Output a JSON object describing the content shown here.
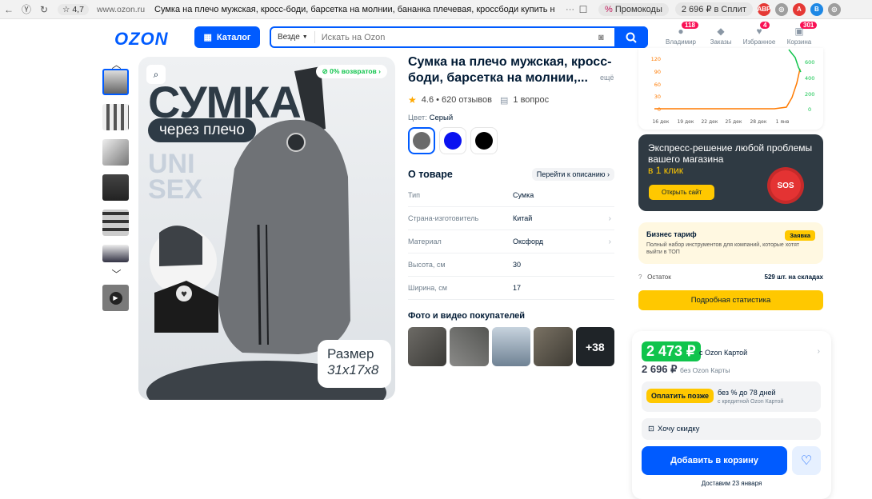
{
  "browser": {
    "rating": "☆ 4,7",
    "url": "www.ozon.ru",
    "title": "Сумка на плечо мужская, кросс-боди, барсетка на молнии, бананка плечевая, кроссбоди купить на OZON...",
    "promo_label": "Промокоды",
    "split_label": "2 696 ₽ в Сплит"
  },
  "header": {
    "logo": "OZON",
    "catalog_label": "Каталог",
    "search_scope": "Везде",
    "search_placeholder": "Искать на Ozon",
    "icons": [
      {
        "label": "Владимир",
        "badge": "118",
        "icon": "user-icon"
      },
      {
        "label": "Заказы",
        "badge": "",
        "icon": "box-icon"
      },
      {
        "label": "Избранное",
        "badge": "4",
        "icon": "heart-icon"
      },
      {
        "label": "Корзина",
        "badge": "301",
        "icon": "cart-icon"
      }
    ]
  },
  "gallery": {
    "returns_badge": "0% возвратов",
    "hero_word": "СУМКА",
    "hero_pill": "через плечо",
    "hero_uni": "UNI",
    "hero_sex": "SEX",
    "size_label": "Размер",
    "size_value": "31x17x8"
  },
  "product": {
    "title": "Сумка на плечо мужская, кросс-боди, барсетка на молнии,...",
    "more": "ещё",
    "rating": "4.6 • 620 отзывов",
    "questions": "1 вопрос",
    "color_label": "Цвет:",
    "color_value": "Серый",
    "swatches": [
      "#6b6b6b",
      "#0a12f0",
      "#000000"
    ],
    "about_title": "О товаре",
    "about_link": "Перейти к описанию",
    "specs": [
      {
        "k": "Тип",
        "v": "Сумка"
      },
      {
        "k": "Страна-изготовитель",
        "v": "Китай"
      },
      {
        "k": "Материал",
        "v": "Оксфорд"
      },
      {
        "k": "Высота, см",
        "v": "30"
      },
      {
        "k": "Ширина, см",
        "v": "17"
      }
    ],
    "photos_title": "Фото и видео покупателей",
    "photos_more": "+38"
  },
  "sidebar": {
    "chart": {
      "y_left": [
        "120",
        "90",
        "60",
        "30",
        "0"
      ],
      "y_right": [
        "600",
        "400",
        "200",
        "0"
      ],
      "x": [
        "16 дек",
        "19 дек",
        "22 дек",
        "25 дек",
        "28 дек",
        "1 янв"
      ]
    },
    "promo_text_1": "Экспресс-решение любой проблемы вашего магазина",
    "promo_text_2": "в 1 клик",
    "promo_btn": "Открыть сайт",
    "promo_badge": "SOS",
    "biz_title": "Бизнес тариф",
    "biz_tag": "Заявка",
    "biz_desc": "Полный набор инструментов для компаний, которые хотят выйти в ТОП",
    "stock_label": "Остаток",
    "stock_value": "529 шт. на складах",
    "stats_btn": "Подробная статистика"
  },
  "buy": {
    "price_card": "2 473 ₽",
    "price_card_label": "с Ozon Картой",
    "price": "2 696 ₽",
    "price_label": "без Ozon Карты",
    "split_btn": "Оплатить позже",
    "split_a": "без % до 78 дней",
    "split_b": "с кредитной Ozon Картой",
    "discount": "Хочу скидку",
    "cart_btn": "Добавить в корзину",
    "delivery": "Доставим 23 января"
  }
}
